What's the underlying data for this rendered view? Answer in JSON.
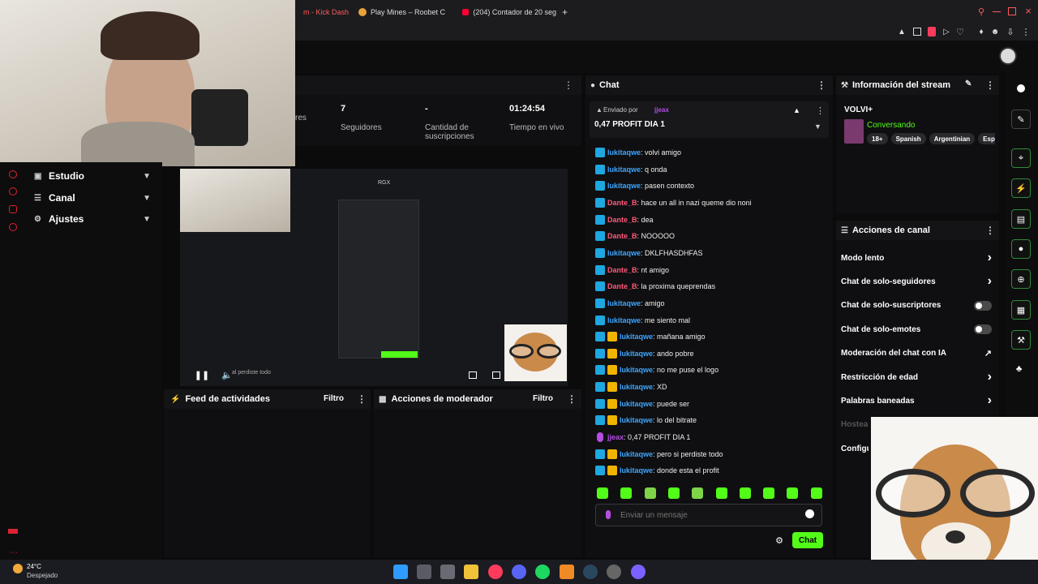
{
  "browser": {
    "tabs": [
      {
        "label": "m - Kick Dashbo"
      },
      {
        "label": "Play Mines – Roobet C"
      },
      {
        "label": "(204) Contador de 20 seg"
      }
    ],
    "new_tab": "+"
  },
  "stats": [
    {
      "value": "",
      "label": "res"
    },
    {
      "value": "7",
      "label": "Seguidores"
    },
    {
      "value": "-",
      "label": "Cantidad de suscripciones"
    },
    {
      "value": "01:24:54",
      "label": "Tiempo en vivo"
    }
  ],
  "sidebar": {
    "items": [
      {
        "label": "Estudio"
      },
      {
        "label": "Canal"
      },
      {
        "label": "Ajustes"
      }
    ]
  },
  "preview": {
    "overlay_text": "RGX",
    "caption": "al perdiste todo"
  },
  "panels": {
    "feed": {
      "title": "Feed de actividades",
      "filter": "Filtro"
    },
    "mod": {
      "title": "Acciones de moderador",
      "filter": "Filtro"
    }
  },
  "chat": {
    "title": "Chat",
    "pinned": {
      "sent_by": "Enviado por",
      "user": "jjeax",
      "message": "0,47 PROFIT DIA 1"
    },
    "messages": [
      {
        "user": "lukitaqwe",
        "text": ": volvi amigo",
        "color": "blue",
        "badges": 1
      },
      {
        "user": "lukitaqwe",
        "text": ": q onda",
        "color": "blue",
        "badges": 1
      },
      {
        "user": "lukitaqwe",
        "text": ": pasen contexto",
        "color": "blue",
        "badges": 1
      },
      {
        "user": "Dante_B",
        "text": ": hace un all in nazi queme dio noni",
        "color": "red",
        "badges": 1
      },
      {
        "user": "Dante_B",
        "text": ": dea",
        "color": "red",
        "badges": 1
      },
      {
        "user": "Dante_B",
        "text": ": NOOOOO",
        "color": "red",
        "badges": 1
      },
      {
        "user": "lukitaqwe",
        "text": ": DKLFHASDHFAS",
        "color": "blue",
        "badges": 1
      },
      {
        "user": "Dante_B",
        "text": ": nt amigo",
        "color": "red",
        "badges": 1
      },
      {
        "user": "Dante_B",
        "text": ": la proxima queprendas",
        "color": "red",
        "badges": 1
      },
      {
        "user": "lukitaqwe",
        "text": ": amigo",
        "color": "blue",
        "badges": 1
      },
      {
        "user": "lukitaqwe",
        "text": ": me siento mal",
        "color": "blue",
        "badges": 1
      },
      {
        "user": "lukitaqwe",
        "text": ": mañana amigo",
        "color": "blue",
        "badges": 2
      },
      {
        "user": "lukitaqwe",
        "text": ": ando pobre",
        "color": "blue",
        "badges": 2
      },
      {
        "user": "lukitaqwe",
        "text": ": no me puse el logo",
        "color": "blue",
        "badges": 2
      },
      {
        "user": "lukitaqwe",
        "text": ": XD",
        "color": "blue",
        "badges": 2
      },
      {
        "user": "lukitaqwe",
        "text": ": puede ser",
        "color": "blue",
        "badges": 2
      },
      {
        "user": "lukitaqwe",
        "text": ": lo del bitrate",
        "color": "blue",
        "badges": 2
      },
      {
        "user": "jjeax",
        "text": ": 0,47 PROFIT DIA 1",
        "color": "purple",
        "badges": 0
      },
      {
        "user": "lukitaqwe",
        "text": ": pero si perdiste todo",
        "color": "blue",
        "badges": 2
      },
      {
        "user": "lukitaqwe",
        "text": ": donde esta el profit",
        "color": "blue",
        "badges": 2
      }
    ],
    "input_placeholder": "Enviar un mensaje",
    "send_label": "Chat"
  },
  "stream_info": {
    "title": "Información del stream",
    "stream_title": "VOLVI+",
    "category": "Conversando",
    "tags": [
      "18+",
      "Spanish",
      "Argentinian",
      "Esp"
    ]
  },
  "channel_actions": {
    "title": "Acciones de canal",
    "items": [
      {
        "label": "Modo lento",
        "control": "chevron"
      },
      {
        "label": "Chat de solo-seguidores",
        "control": "chevron"
      },
      {
        "label": "Chat de solo-suscriptores",
        "control": "toggle"
      },
      {
        "label": "Chat de solo-emotes",
        "control": "toggle"
      },
      {
        "label": "Moderación del chat con IA",
        "control": "external"
      },
      {
        "label": "Restricción de edad",
        "control": "chevron"
      },
      {
        "label": "Palabras baneadas",
        "control": "chevron"
      },
      {
        "label": "Hostear",
        "control": "none"
      },
      {
        "label": "Configu",
        "control": "none"
      }
    ]
  },
  "weather": {
    "temp": "24°C",
    "condition": "Despejado"
  },
  "colors": {
    "accent": "#53fc18",
    "bg": "#0b0b0c",
    "panel": "#141416",
    "user_blue": "#3ea6ff",
    "user_red": "#ff5a7a",
    "user_purple": "#b34ee0"
  }
}
